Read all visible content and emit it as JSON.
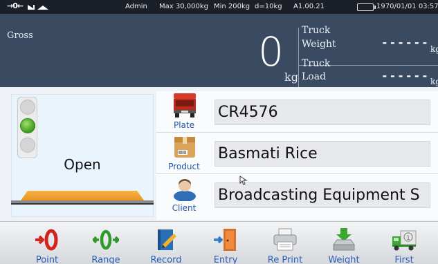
{
  "status_bar": {
    "zero_indicator": "→0←",
    "user": "Admin",
    "max_capacity": "Max 30,000kg",
    "min_capacity": "Min 200kg",
    "division": "d=10kg",
    "version": "A1.00.21",
    "datetime": "1970/01/01 03:57"
  },
  "weight": {
    "mode_label": "Gross",
    "value": "0",
    "unit": "kg",
    "truck_weight": {
      "label_line1": "Truck",
      "label_line2": "Weight",
      "value": "------",
      "unit": "kg"
    },
    "truck_load": {
      "label_line1": "Truck",
      "label_line2": "Load",
      "value": "------",
      "unit": "kg"
    }
  },
  "gate": {
    "status": "Open",
    "traffic_light_active": "green"
  },
  "info": {
    "plate": {
      "label": "Plate",
      "value": "CR4576"
    },
    "product": {
      "label": "Product",
      "value": "Basmati Rice"
    },
    "client": {
      "label": "Client",
      "value": "Broadcasting Equipment S"
    }
  },
  "toolbar": [
    {
      "label": "Point",
      "icon": "zero-point-icon"
    },
    {
      "label": "Range",
      "icon": "zero-range-icon"
    },
    {
      "label": "Record",
      "icon": "record-book-icon"
    },
    {
      "label": "Entry",
      "icon": "entry-door-icon"
    },
    {
      "label": "Re Print",
      "icon": "printer-icon"
    },
    {
      "label": "Weight",
      "icon": "weight-download-icon"
    },
    {
      "label": "First",
      "icon": "first-weigh-truck-icon"
    }
  ],
  "colors": {
    "status_bar_bg": "#1b1f27",
    "weight_panel_bg": "#3a4b61",
    "label_blue": "#2d5fb5",
    "traffic_green": "#3a9b1d",
    "platform_orange": "#f0a030"
  }
}
